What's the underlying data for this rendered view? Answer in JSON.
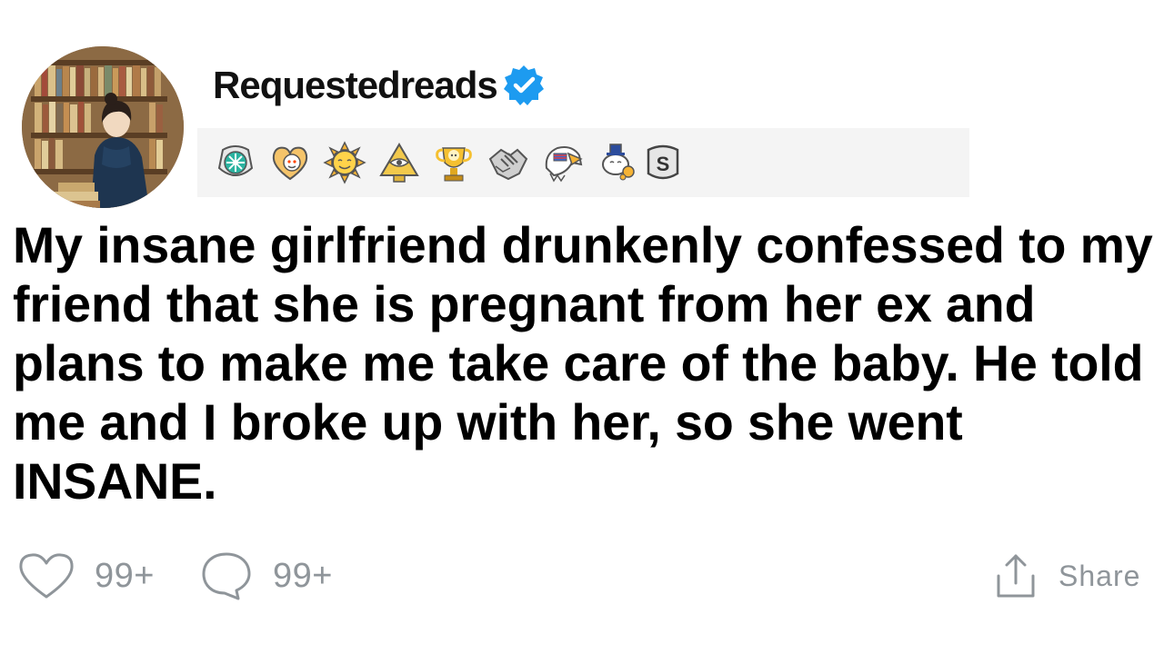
{
  "post": {
    "author": {
      "username": "Requestedreads",
      "verified": true,
      "verified_color": "#1d9bf0",
      "avatar_icon": "bookstore-reader-avatar"
    },
    "awards": [
      {
        "name": "rocket-like-award-icon"
      },
      {
        "name": "wholesome-heart-award-icon"
      },
      {
        "name": "sunny-award-icon"
      },
      {
        "name": "illuminati-pyramid-award-icon"
      },
      {
        "name": "gold-trophy-snoo-award-icon"
      },
      {
        "name": "handshake-award-icon"
      },
      {
        "name": "eagle-award-icon"
      },
      {
        "name": "bravo-snoo-award-icon"
      },
      {
        "name": "silver-s-award-icon"
      }
    ],
    "title": "My insane girlfriend drunkenly confessed to my friend that she is pregnant from her ex and plans to make me take care of the baby. He told me and I broke up with her, so she went INSANE.",
    "actions": {
      "likes": "99+",
      "comments": "99+",
      "share_label": "Share"
    },
    "colors": {
      "text": "#000000",
      "muted": "#8f959a",
      "awards_bg": "#f4f4f4"
    }
  }
}
